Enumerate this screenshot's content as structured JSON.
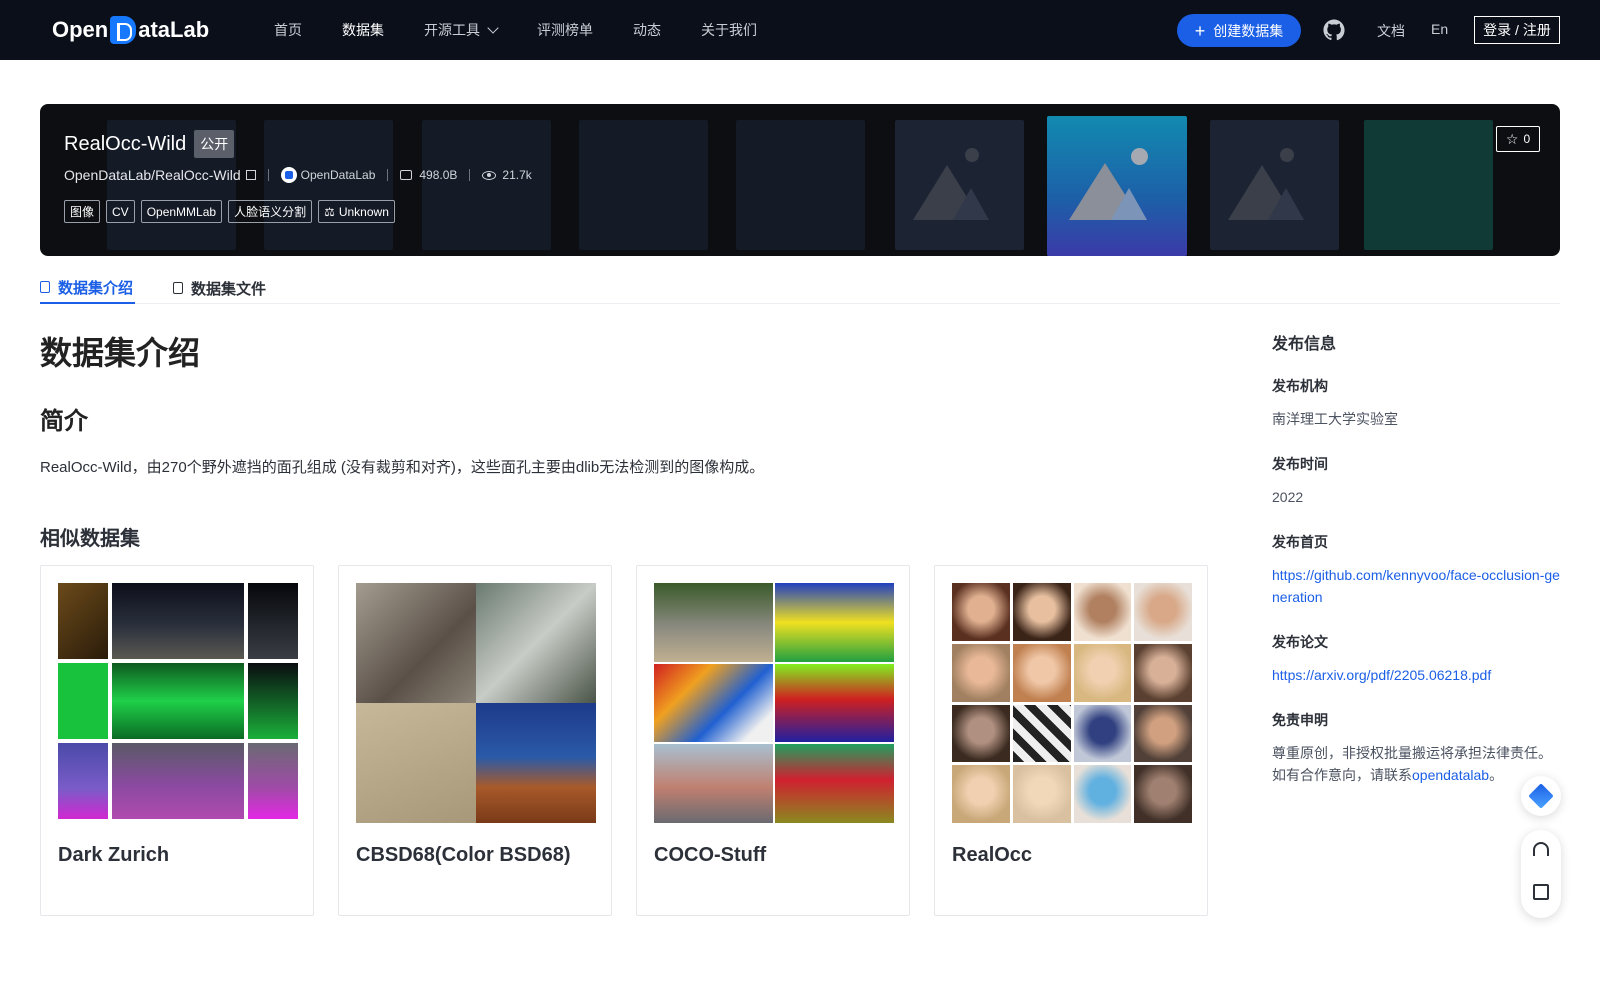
{
  "header": {
    "logo_text_left": "Open",
    "logo_text_right": "ataLab",
    "nav": [
      "首页",
      "数据集",
      "开源工具",
      "评测榜单",
      "动态",
      "关于我们"
    ],
    "create_label": "创建数据集",
    "docs_label": "文档",
    "lang_label": "En",
    "login_label": "登录 / 注册"
  },
  "dataset": {
    "title": "RealOcc-Wild",
    "visibility": "公开",
    "path": "OpenDataLab/RealOcc-Wild",
    "org": "OpenDataLab",
    "size": "498.0B",
    "views": "21.7k",
    "tags": [
      "图像",
      "CV",
      "OpenMMLab",
      "人脸语义分割"
    ],
    "license": "Unknown",
    "stars": "0"
  },
  "tabs": {
    "intro": "数据集介绍",
    "files": "数据集文件"
  },
  "content": {
    "h1": "数据集介绍",
    "h2": "简介",
    "intro": "RealOcc-Wild，由270个野外遮挡的面孔组成 (没有裁剪和对齐)，这些面孔主要由dlib无法检测到的图像构成。",
    "similar_title": "相似数据集",
    "similar": [
      "Dark Zurich",
      "CBSD68(Color BSD68)",
      "COCO-Stuff",
      "RealOcc"
    ]
  },
  "sidebar": {
    "title": "发布信息",
    "org_label": "发布机构",
    "org_value": "南洋理工大学实验室",
    "time_label": "发布时间",
    "time_value": "2022",
    "home_label": "发布首页",
    "home_value": "https://github.com/kennyvoo/face-occlusion-generation",
    "paper_label": "发布论文",
    "paper_value": "https://arxiv.org/pdf/2205.06218.pdf",
    "disclaimer_label": "免责申明",
    "disclaimer_text": "尊重原创，非授权批量搬运将承担法律责任。如有合作意向，请联系",
    "disclaimer_link": "opendatalab",
    "disclaimer_end": "。"
  },
  "colors": {
    "accent": "#1b5fe6",
    "topbar": "#0b0f1a"
  }
}
